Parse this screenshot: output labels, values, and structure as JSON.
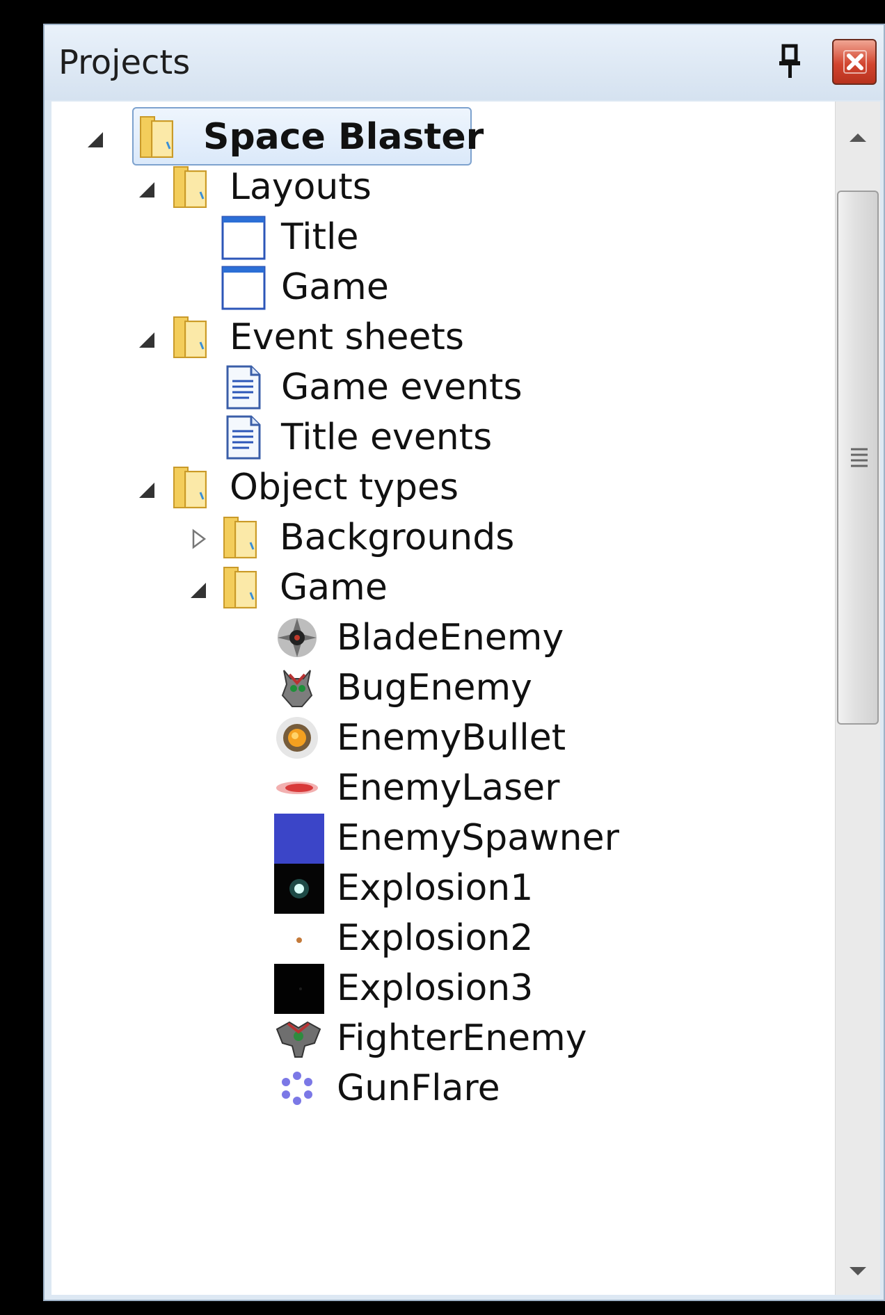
{
  "panel": {
    "title": "Projects",
    "pin_icon": "pin-icon",
    "close_icon": "close-icon",
    "accent_close": "#d2452f"
  },
  "tree": {
    "root": {
      "label": "Space Blaster",
      "icon": "folder-icon",
      "expanded": true,
      "selected": true
    },
    "layouts": {
      "label": "Layouts",
      "items": [
        {
          "label": "Title",
          "icon": "layout-icon"
        },
        {
          "label": "Game",
          "icon": "layout-icon"
        }
      ]
    },
    "event_sheets": {
      "label": "Event sheets",
      "items": [
        {
          "label": "Game events",
          "icon": "event-sheet-icon"
        },
        {
          "label": "Title events",
          "icon": "event-sheet-icon"
        }
      ]
    },
    "object_types": {
      "label": "Object types",
      "backgrounds": {
        "label": "Backgrounds",
        "expanded": false
      },
      "game": {
        "label": "Game",
        "expanded": true,
        "items": [
          {
            "label": "BladeEnemy",
            "icon": "blade-enemy-sprite-icon"
          },
          {
            "label": "BugEnemy",
            "icon": "bug-enemy-sprite-icon"
          },
          {
            "label": "EnemyBullet",
            "icon": "enemy-bullet-sprite-icon"
          },
          {
            "label": "EnemyLaser",
            "icon": "enemy-laser-sprite-icon"
          },
          {
            "label": "EnemySpawner",
            "icon": "enemy-spawner-sprite-icon"
          },
          {
            "label": "Explosion1",
            "icon": "explosion1-sprite-icon"
          },
          {
            "label": "Explosion2",
            "icon": "explosion2-sprite-icon"
          },
          {
            "label": "Explosion3",
            "icon": "explosion3-sprite-icon"
          },
          {
            "label": "FighterEnemy",
            "icon": "fighter-enemy-sprite-icon"
          },
          {
            "label": "GunFlare",
            "icon": "gun-flare-sprite-icon"
          }
        ]
      }
    }
  }
}
